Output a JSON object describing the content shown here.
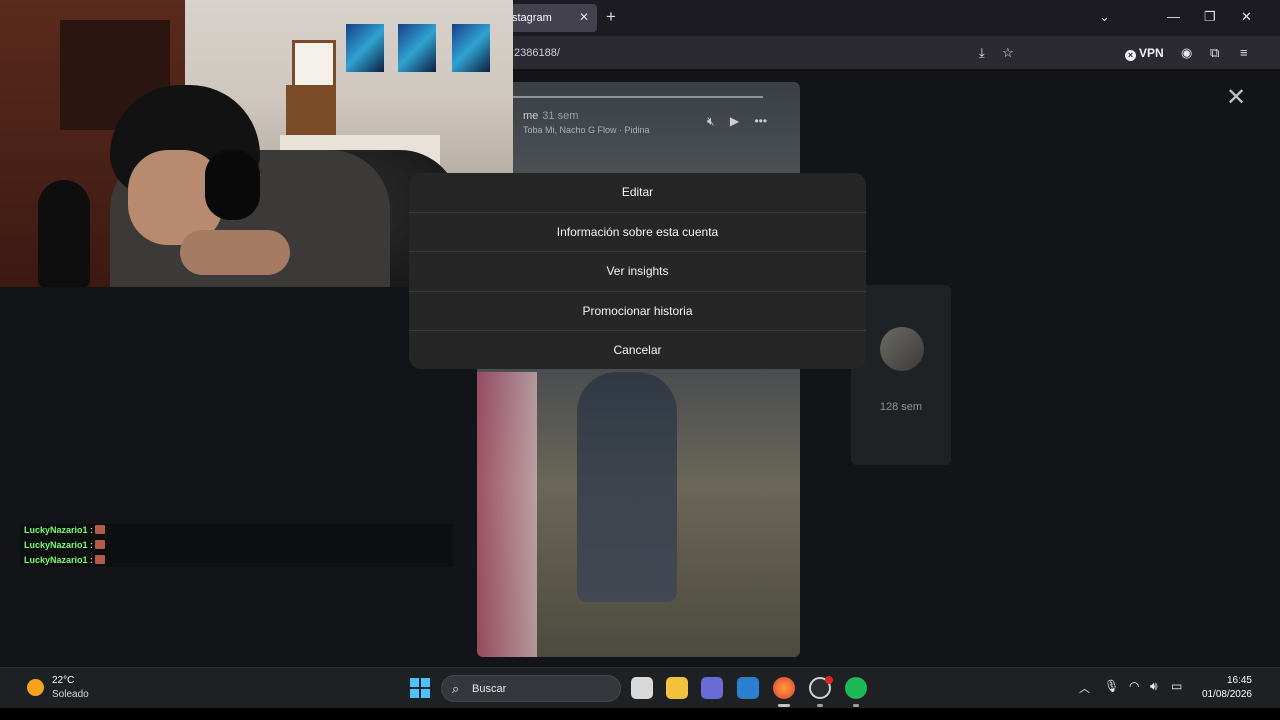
{
  "browser": {
    "tab_title": "stagram",
    "tab_close": "✕",
    "new_tab": "+",
    "url": "2386188/",
    "vpn_label": "VPN"
  },
  "story": {
    "username_fragment": "me",
    "time_ago": "31 sem",
    "song": "Toba Mi, Nacho G Flow · Pidina",
    "close": "✕"
  },
  "side_story": {
    "time_ago": "128 sem"
  },
  "menu": {
    "items": [
      {
        "label": "Editar"
      },
      {
        "label": "Información sobre esta cuenta"
      },
      {
        "label": "Ver insights"
      },
      {
        "label": "Promocionar historia"
      },
      {
        "label": "Cancelar"
      }
    ]
  },
  "chat": {
    "lines": [
      {
        "user": "LuckyNazario1 :"
      },
      {
        "user": "LuckyNazario1 :"
      },
      {
        "user": "LuckyNazario1 :"
      }
    ]
  },
  "taskbar": {
    "weather_temp": "22°C",
    "weather_desc": "Soleado",
    "search_placeholder": "Buscar",
    "time": "16:45",
    "date": "01/08/2026"
  },
  "colors": {
    "chat_name": "#7cfc6c",
    "menu_bg": "#262626",
    "start_blue": "#4cc2ff",
    "spotify_green": "#1db954"
  }
}
